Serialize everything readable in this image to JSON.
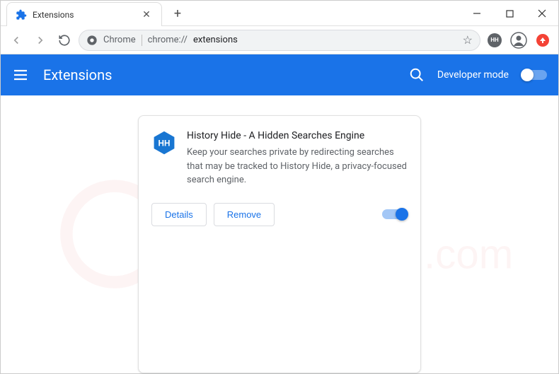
{
  "tab": {
    "title": "Extensions"
  },
  "omnibox": {
    "label": "Chrome",
    "url_prefix": "chrome://",
    "url_rest": "extensions"
  },
  "header": {
    "title": "Extensions",
    "dev_mode_label": "Developer mode"
  },
  "extension": {
    "name": "History Hide - A Hidden Searches Engine",
    "description": "Keep your searches private by redirecting searches that may be tracked to History Hide, a privacy-focused search engine.",
    "logo_text": "HH",
    "details_label": "Details",
    "remove_label": "Remove"
  }
}
